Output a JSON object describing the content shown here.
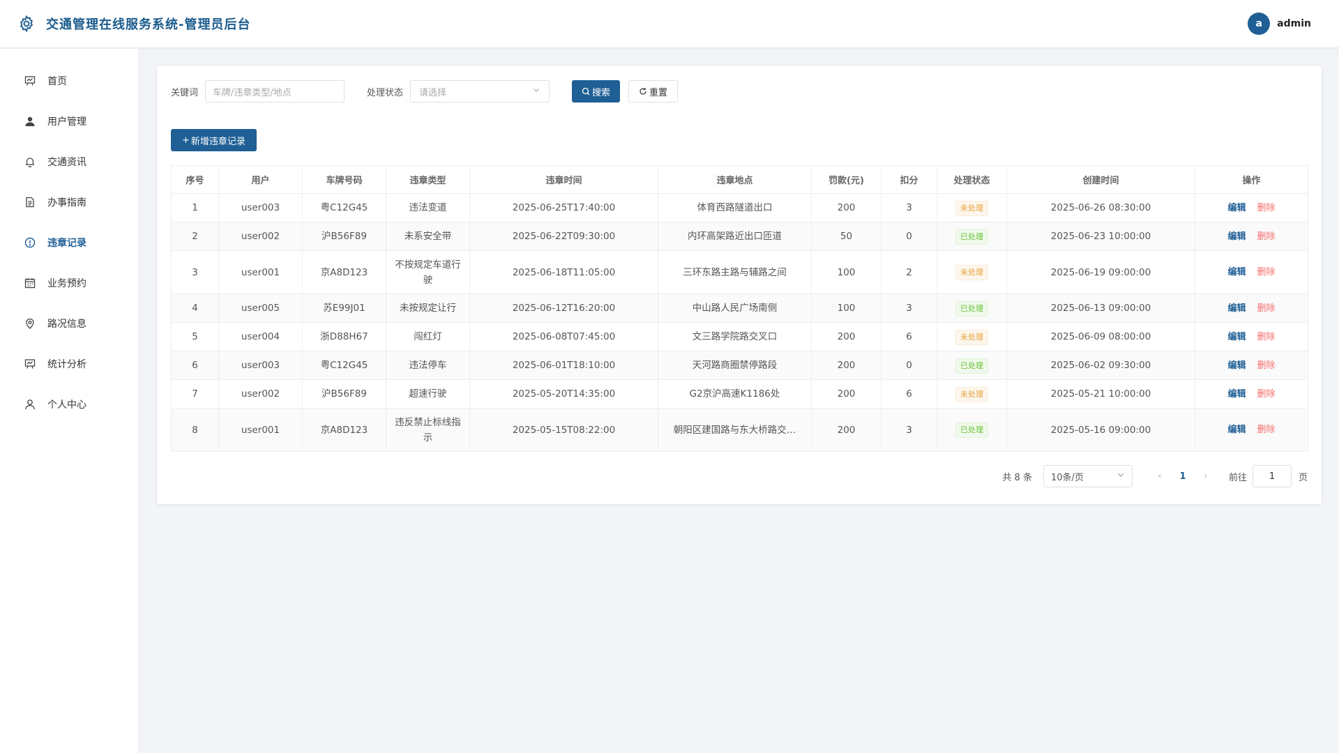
{
  "header": {
    "title": "交通管理在线服务系统-管理员后台",
    "avatar_letter": "a",
    "username": "admin"
  },
  "sidebar": {
    "items": [
      {
        "label": "首页",
        "icon": "chart-board-icon"
      },
      {
        "label": "用户管理",
        "icon": "user-icon"
      },
      {
        "label": "交通资讯",
        "icon": "bell-icon"
      },
      {
        "label": "办事指南",
        "icon": "document-icon"
      },
      {
        "label": "违章记录",
        "icon": "warning-circle-icon",
        "active": true
      },
      {
        "label": "业务预约",
        "icon": "calendar-icon"
      },
      {
        "label": "路况信息",
        "icon": "location-icon"
      },
      {
        "label": "统计分析",
        "icon": "chart-board-icon"
      },
      {
        "label": "个人中心",
        "icon": "user-outline-icon"
      }
    ]
  },
  "filters": {
    "keyword_label": "关键词",
    "keyword_placeholder": "车牌/违章类型/地点",
    "status_label": "处理状态",
    "status_placeholder": "请选择",
    "search_label": "搜索",
    "reset_label": "重置"
  },
  "add_button": "新增违章记录",
  "table": {
    "columns": [
      "序号",
      "用户",
      "车牌号码",
      "违章类型",
      "违章时间",
      "违章地点",
      "罚款(元)",
      "扣分",
      "处理状态",
      "创建时间",
      "操作"
    ],
    "rows": [
      {
        "no": "1",
        "user": "user003",
        "plate": "粤C12G45",
        "type": "违法变道",
        "time": "2025-06-25T17:40:00",
        "place": "体育西路隧道出口",
        "fine": "200",
        "points": "3",
        "status": "未处理",
        "created": "2025-06-26 08:30:00"
      },
      {
        "no": "2",
        "user": "user002",
        "plate": "沪B56F89",
        "type": "未系安全带",
        "time": "2025-06-22T09:30:00",
        "place": "内环高架路近出口匝道",
        "fine": "50",
        "points": "0",
        "status": "已处理",
        "created": "2025-06-23 10:00:00"
      },
      {
        "no": "3",
        "user": "user001",
        "plate": "京A8D123",
        "type": "不按规定车道行驶",
        "time": "2025-06-18T11:05:00",
        "place": "三环东路主路与辅路之间",
        "fine": "100",
        "points": "2",
        "status": "未处理",
        "created": "2025-06-19 09:00:00"
      },
      {
        "no": "4",
        "user": "user005",
        "plate": "苏E99J01",
        "type": "未按规定让行",
        "time": "2025-06-12T16:20:00",
        "place": "中山路人民广场南侧",
        "fine": "100",
        "points": "3",
        "status": "已处理",
        "created": "2025-06-13 09:00:00"
      },
      {
        "no": "5",
        "user": "user004",
        "plate": "浙D88H67",
        "type": "闯红灯",
        "time": "2025-06-08T07:45:00",
        "place": "文三路学院路交叉口",
        "fine": "200",
        "points": "6",
        "status": "未处理",
        "created": "2025-06-09 08:00:00"
      },
      {
        "no": "6",
        "user": "user003",
        "plate": "粤C12G45",
        "type": "违法停车",
        "time": "2025-06-01T18:10:00",
        "place": "天河路商圈禁停路段",
        "fine": "200",
        "points": "0",
        "status": "已处理",
        "created": "2025-06-02 09:30:00"
      },
      {
        "no": "7",
        "user": "user002",
        "plate": "沪B56F89",
        "type": "超速行驶",
        "time": "2025-05-20T14:35:00",
        "place": "G2京沪高速K1186处",
        "fine": "200",
        "points": "6",
        "status": "未处理",
        "created": "2025-05-21 10:00:00"
      },
      {
        "no": "8",
        "user": "user001",
        "plate": "京A8D123",
        "type": "违反禁止标线指示",
        "time": "2025-05-15T08:22:00",
        "place": "朝阳区建国路与东大桥路交…",
        "fine": "200",
        "points": "3",
        "status": "已处理",
        "created": "2025-05-16 09:00:00"
      }
    ],
    "edit_label": "编辑",
    "delete_label": "删除"
  },
  "pagination": {
    "total_text": "共 8 条",
    "page_size": "10条/页",
    "current_page": "1",
    "goto_label": "前往",
    "goto_value": "1",
    "page_suffix": "页"
  },
  "colors": {
    "primary": "#1f5f95",
    "pending": "#e6a23c",
    "done": "#67c23a",
    "danger": "#f56c6c"
  }
}
